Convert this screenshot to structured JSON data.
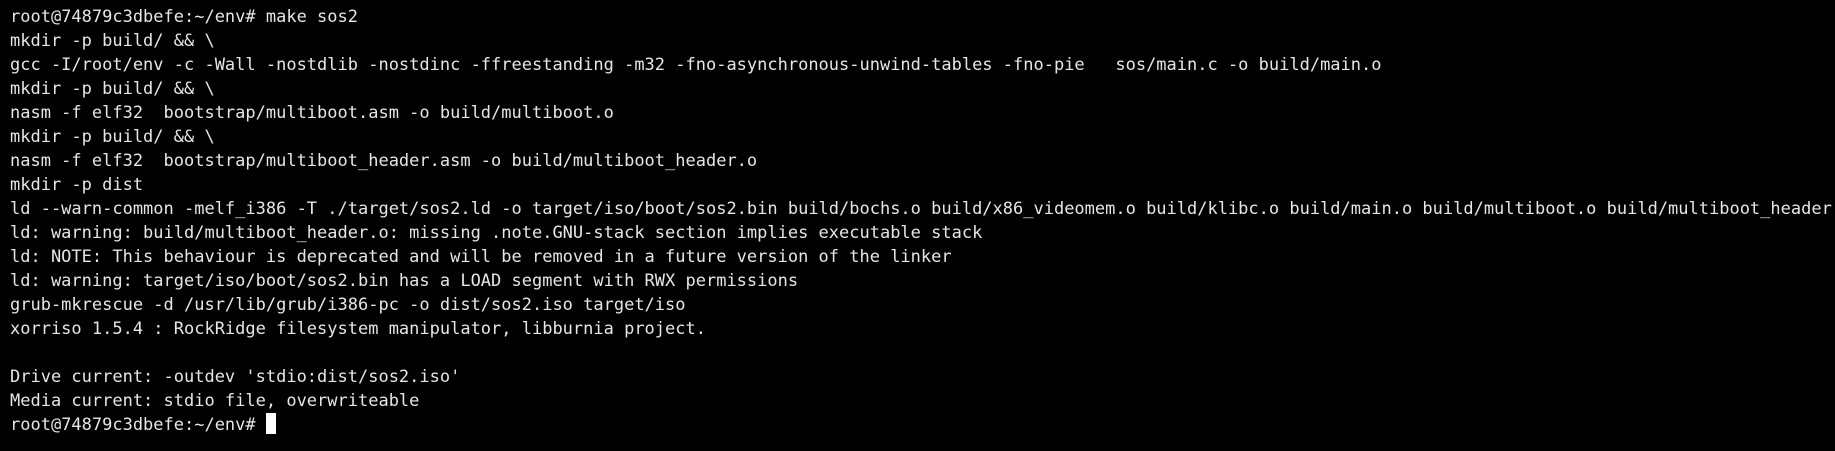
{
  "terminal": {
    "background": "#000000",
    "foreground": "#e6e6e6",
    "cursor_color": "#ffffff",
    "lines": [
      "root@74879c3dbefe:~/env# make sos2",
      "mkdir -p build/ && \\",
      "gcc -I/root/env -c -Wall -nostdlib -nostdinc -ffreestanding -m32 -fno-asynchronous-unwind-tables -fno-pie   sos/main.c -o build/main.o",
      "mkdir -p build/ && \\",
      "nasm -f elf32  bootstrap/multiboot.asm -o build/multiboot.o",
      "mkdir -p build/ && \\",
      "nasm -f elf32  bootstrap/multiboot_header.asm -o build/multiboot_header.o",
      "mkdir -p dist",
      "ld --warn-common -melf_i386 -T ./target/sos2.ld -o target/iso/boot/sos2.bin build/bochs.o build/x86_videomem.o build/klibc.o build/main.o build/multiboot.o build/multiboot_header.o",
      "ld: warning: build/multiboot_header.o: missing .note.GNU-stack section implies executable stack",
      "ld: NOTE: This behaviour is deprecated and will be removed in a future version of the linker",
      "ld: warning: target/iso/boot/sos2.bin has a LOAD segment with RWX permissions",
      "grub-mkrescue -d /usr/lib/grub/i386-pc -o dist/sos2.iso target/iso",
      "xorriso 1.5.4 : RockRidge filesystem manipulator, libburnia project.",
      "",
      "Drive current: -outdev 'stdio:dist/sos2.iso'",
      "Media current: stdio file, overwriteable"
    ],
    "prompt": "root@74879c3dbefe:~/env#"
  }
}
